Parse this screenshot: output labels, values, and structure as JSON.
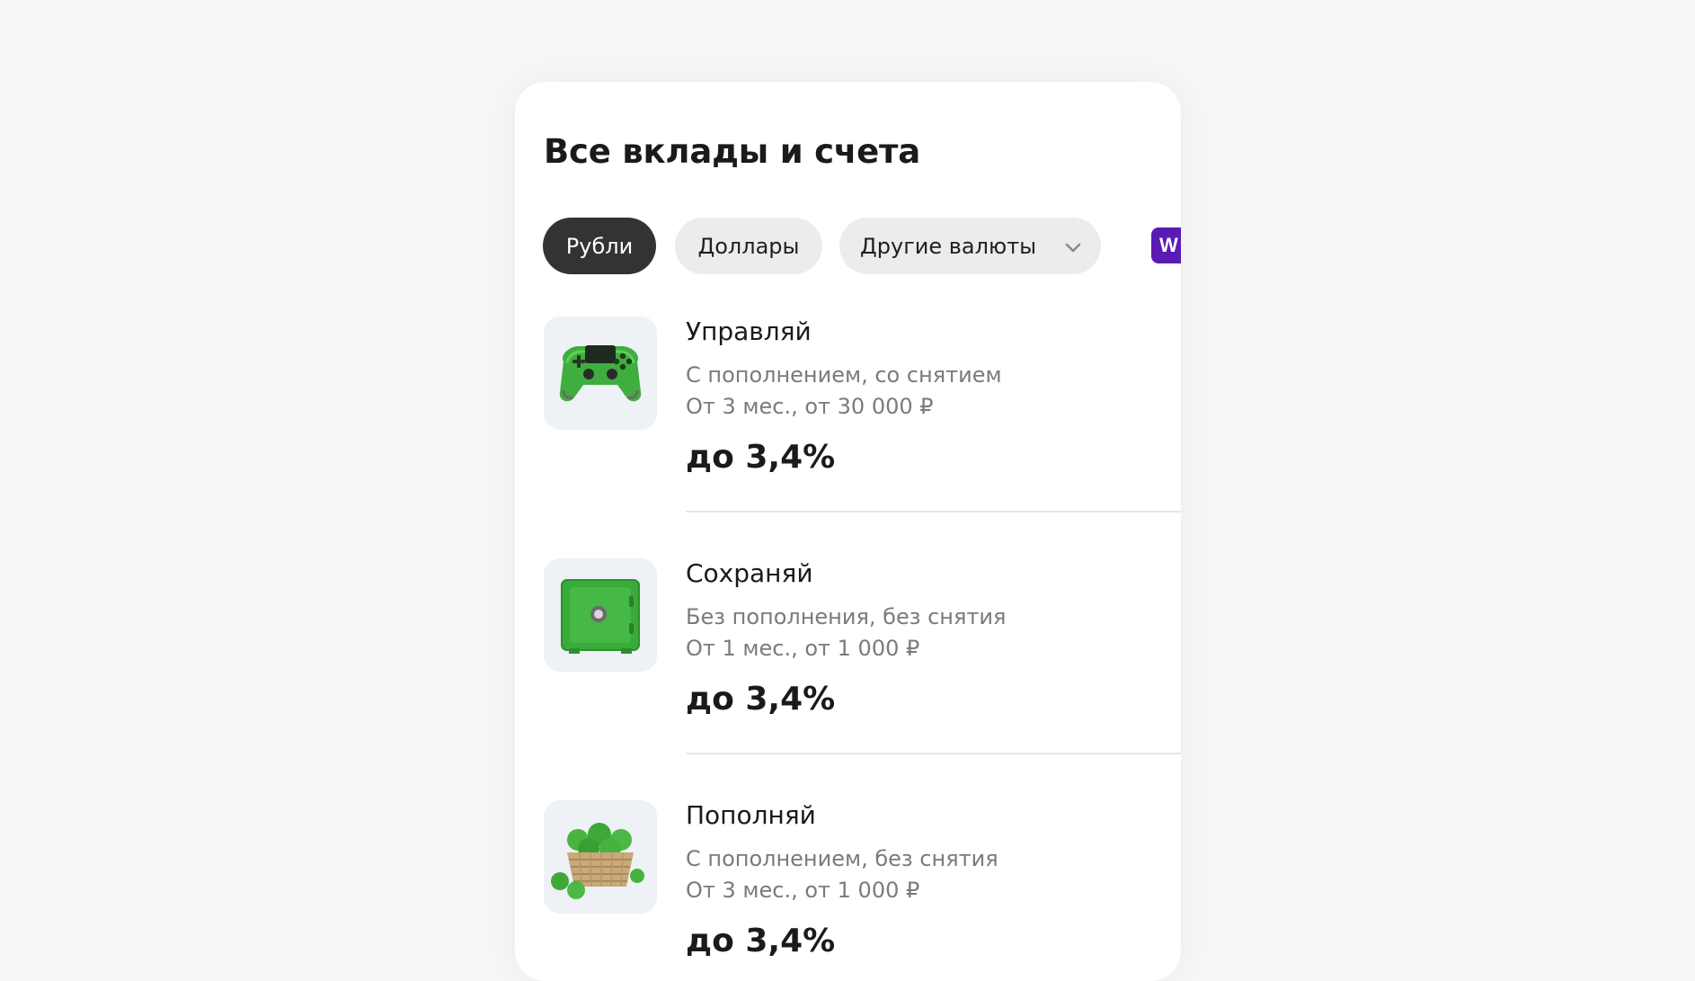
{
  "page": {
    "title": "Все вклады и счета"
  },
  "filters": {
    "rub": "Рубли",
    "usd": "Доллары",
    "other": "Другие валюты",
    "badge": "W"
  },
  "colors": {
    "active_chip": "#333333",
    "inactive_chip": "#ececef",
    "badge": "#5a1bb5",
    "thumb_bg": "#eef1f5",
    "product_green": "#3aaa3a"
  },
  "products": [
    {
      "name": "Управляй",
      "line1": "С пополнением, со снятием",
      "line2": "От 3 мес., от 30 000 ₽",
      "rate": "до 3,4%",
      "icon": "gamepad-icon"
    },
    {
      "name": "Сохраняй",
      "line1": "Без пополнения, без снятия",
      "line2": "От 1 мес., от 1 000 ₽",
      "rate": "до 3,4%",
      "icon": "safe-icon"
    },
    {
      "name": "Пополняй",
      "line1": "С пополнением, без снятия",
      "line2": "От 3 мес., от 1 000 ₽",
      "rate": "до 3,4%",
      "icon": "apple-basket-icon"
    }
  ]
}
